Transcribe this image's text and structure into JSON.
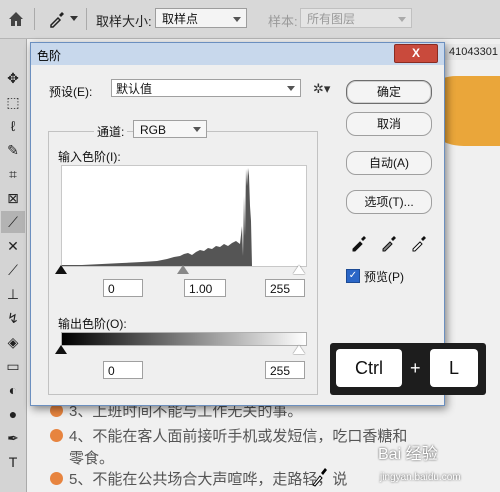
{
  "options_bar": {
    "sample_size_label": "取样大小:",
    "sample_size_value": "取样点",
    "sample_label": "样本:",
    "sample_value": "所有图层"
  },
  "document": {
    "number_text": "41043301",
    "lines": [
      {
        "bullet": true,
        "text": "3、上班时间不能与工作无关的事。"
      },
      {
        "bullet": true,
        "text": "4、不能在客人面前接听手机或发短信，吃口香糖和"
      },
      {
        "bullet": false,
        "text": "零食。"
      },
      {
        "bullet": true,
        "text": "5、不能在公共场合大声喧哗，走路轻，说"
      }
    ]
  },
  "dialog": {
    "title": "色阶",
    "close_label": "X",
    "preset_label": "预设(E):",
    "preset_value": "默认值",
    "channel_label": "通道:",
    "channel_value": "RGB",
    "input_levels_label": "输入色阶(I):",
    "input_values": {
      "black": "0",
      "mid": "1.00",
      "white": "255"
    },
    "output_levels_label": "输出色阶(O):",
    "output_values": {
      "black": "0",
      "white": "255"
    },
    "buttons": {
      "ok": "确定",
      "cancel": "取消",
      "auto": "自动(A)",
      "options": "选项(T)..."
    },
    "preview_label": "预览(P)",
    "preview_checked": true
  },
  "shortcut": {
    "key1": "Ctrl",
    "plus": "+",
    "key2": "L"
  },
  "watermark": {
    "text": "Bai 经验",
    "sub": "jingyan.baidu.com"
  },
  "colors": {
    "accent_blue": "#2a66c7",
    "close_red": "#c94a3c",
    "bullet_orange": "#e7843f"
  }
}
